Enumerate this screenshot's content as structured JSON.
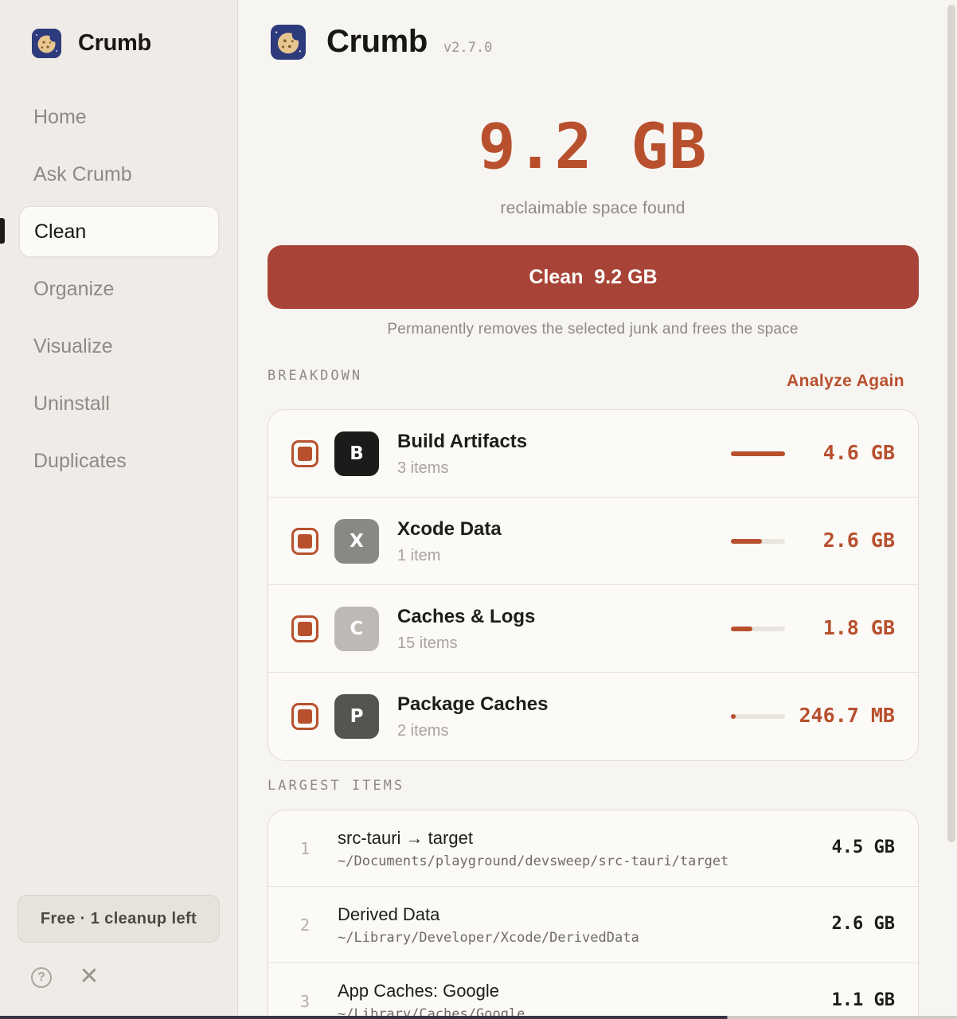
{
  "app": {
    "name": "Crumb",
    "version": "v2.7.0",
    "logo_icon": "cookie-icon",
    "colors": {
      "accent": "#b8502e",
      "primary_button": "#a84437",
      "logo_bg": "#2d3a7c"
    }
  },
  "sidebar": {
    "items": [
      {
        "label": "Home",
        "active": false
      },
      {
        "label": "Ask Crumb",
        "active": false
      },
      {
        "label": "Clean",
        "active": true
      },
      {
        "label": "Organize",
        "active": false
      },
      {
        "label": "Visualize",
        "active": false
      },
      {
        "label": "Uninstall",
        "active": false
      },
      {
        "label": "Duplicates",
        "active": false
      }
    ],
    "plan_badge": "Free · 1 cleanup left",
    "help_icon": "question-circle-icon",
    "close_icon": "close-icon"
  },
  "main": {
    "reclaimable": "9.2 GB",
    "reclaimable_caption": "reclaimable space found",
    "clean_button": "Clean  9.2 GB",
    "clean_note": "Permanently removes the selected junk and frees the space",
    "breakdown_label": "BREAKDOWN",
    "analyze_again": "Analyze Again",
    "breakdown": [
      {
        "letter": "B",
        "name": "Build Artifacts",
        "count": "3 items",
        "size": "4.6 GB",
        "share": 1.0,
        "tile_color": "#1c1b19",
        "checked": true
      },
      {
        "letter": "X",
        "name": "Xcode Data",
        "count": "1 item",
        "size": "2.6 GB",
        "share": 0.57,
        "tile_color": "#8a8883",
        "checked": true
      },
      {
        "letter": "C",
        "name": "Caches & Logs",
        "count": "15 items",
        "size": "1.8 GB",
        "share": 0.39,
        "tile_color": "#bdbab5",
        "checked": true
      },
      {
        "letter": "P",
        "name": "Package Caches",
        "count": "2 items",
        "size": "246.7 MB",
        "share": 0.05,
        "tile_color": "#565450",
        "checked": true
      }
    ],
    "largest_label": "LARGEST ITEMS",
    "largest": [
      {
        "rank": "1",
        "name": "src-tauri → target",
        "path": "~/Documents/playground/devsweep/src-tauri/target",
        "size": "4.5 GB"
      },
      {
        "rank": "2",
        "name": "Derived Data",
        "path": "~/Library/Developer/Xcode/DerivedData",
        "size": "2.6 GB"
      },
      {
        "rank": "3",
        "name": "App Caches: Google",
        "path": "~/Library/Caches/Google",
        "size": "1.1 GB"
      }
    ]
  }
}
